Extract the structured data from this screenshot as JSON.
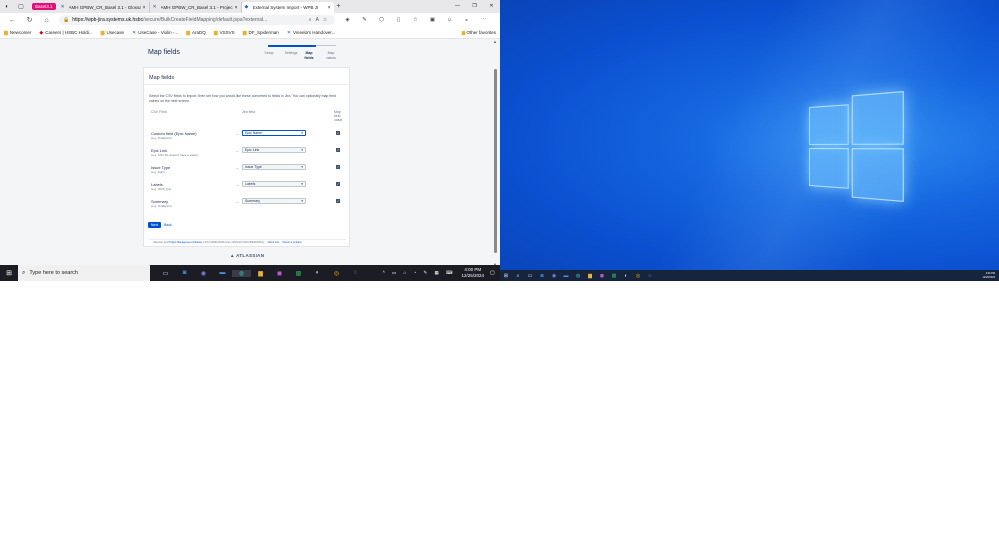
{
  "browser": {
    "group_label": "Basel3.1",
    "tabs": [
      {
        "title": "AMH GPBW_CR_Basel 3.1 - Glossar",
        "active": false
      },
      {
        "title": "AMH GPBW_CR_Basel 3.1 - Projec",
        "active": false
      },
      {
        "title": "External System Import - WPB JI",
        "active": true
      }
    ],
    "url_host": "https://wpb-jira.systems.uk.hsbc",
    "url_path": "/secure/BulkCreateFieldMapping!default.jspa?external...",
    "favorites": [
      {
        "label": "Newcomer",
        "icon": "folder"
      },
      {
        "label": "Careers | HSBC Holdi...",
        "icon": "hsbc"
      },
      {
        "label": "Usecase",
        "icon": "folder"
      },
      {
        "label": "UseCase - Violin -...",
        "icon": "jira"
      },
      {
        "label": "AraDQ",
        "icon": "folder"
      },
      {
        "label": "VSSVS",
        "icon": "folder"
      },
      {
        "label": "DF_Spiderman",
        "icon": "folder"
      },
      {
        "label": "Vineela's Handover...",
        "icon": "jira"
      }
    ],
    "other_favorites": "Other favorites"
  },
  "page": {
    "title": "Map fields",
    "steps": [
      "Setup",
      "Settings",
      "Map fields",
      "Map values"
    ],
    "card_title": "Map fields",
    "intro": "Select the CSV fields to import, then set how you would like these converted to fields in Jira. You can optionally map field values on the next screen.",
    "col_csv": "CSV Field",
    "col_jira": "Jira field",
    "col_map": "Map field value",
    "rows": [
      {
        "csv": "Custom field (Epic Name)",
        "eg": "(e.g. TestEpic1)",
        "jira": "Epic Name",
        "focus": true
      },
      {
        "csv": "Epic Link",
        "eg": "(e.g. CSV file doesn't have a value)",
        "jira": "Epic Link",
        "focus": false
      },
      {
        "csv": "Issue Type",
        "eg": "(e.g. Epic)",
        "jira": "Issue Type",
        "focus": false
      },
      {
        "csv": "Labels",
        "eg": "(e.g. 2025_Q1)",
        "jira": "Labels",
        "focus": false
      },
      {
        "csv": "Summary",
        "eg": "(e.g. TestEpic1)",
        "jira": "Summary",
        "focus": false
      }
    ],
    "next_label": "Next",
    "back_label": "Back",
    "footer_text": "Atlassian Jira ",
    "footer_link": "Project Management Software",
    "footer_version": " (v9.12.26#9120026-sha1:1296c0d:1043cc880d6d36cc)",
    "footer_about": "About Jira",
    "footer_report": "Report a problem",
    "atlassian": "ATLASSIAN"
  },
  "taskbar": {
    "search_placeholder": "Type here to search",
    "time": "4:00 PM",
    "date": "12/25/2024",
    "time2": "4:00 PM",
    "date2": "12/25/2024"
  }
}
